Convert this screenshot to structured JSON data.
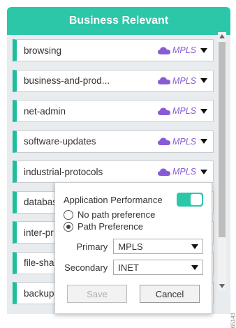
{
  "panel": {
    "title": "Business Relevant"
  },
  "rows": [
    {
      "name": "browsing",
      "path": "MPLS"
    },
    {
      "name": "business-and-prod...",
      "path": "MPLS"
    },
    {
      "name": "net-admin",
      "path": "MPLS"
    },
    {
      "name": "software-updates",
      "path": "MPLS"
    },
    {
      "name": "industrial-protocols",
      "path": "MPLS"
    },
    {
      "name": "databas",
      "path": ""
    },
    {
      "name": "inter-pr",
      "path": ""
    },
    {
      "name": "file-shar",
      "path": ""
    },
    {
      "name": "backup-",
      "path": ""
    }
  ],
  "popup": {
    "perf_label": "Application Performance",
    "perf_enabled": true,
    "radio_none": "No path preference",
    "radio_pref": "Path Preference",
    "primary_label": "Primary",
    "primary_value": "MPLS",
    "secondary_label": "Secondary",
    "secondary_value": "INET",
    "save_label": "Save",
    "cancel_label": "Cancel"
  },
  "colors": {
    "accent": "#2cc6a9",
    "row_bar": "#1dbf9c",
    "path_purple": "#8a5bd6"
  },
  "icons": {
    "cloud": "cloud-icon",
    "caret": "chevron-down-icon"
  },
  "watermark": "65143"
}
